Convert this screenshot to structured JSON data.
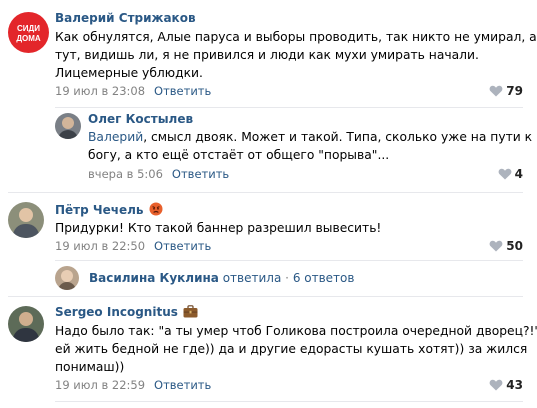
{
  "comments": [
    {
      "author": "Валерий Стрижаков",
      "avatar_text": [
        "СИДИ",
        "ДОМА"
      ],
      "lines": [
        "Как обнулятся, Алые паруса и выборы проводить, так никто не умирал, а",
        "тут, видишь ли, я не привился и люди как мухи умирать начали.",
        "Лицемерные ублюдки."
      ],
      "date": "19 июл в 23:08",
      "reply_label": "Ответить",
      "likes": "79"
    },
    {
      "author": "Олег Костылев",
      "mention": "Валерий",
      "lines": [
        ", смысл двояк. Может и такой. Типа, сколько уже на пути к",
        "богу, а кто ещё отстаёт от общего \"порыва\"..."
      ],
      "date": "вчера в 5:06",
      "reply_label": "Ответить",
      "likes": "4"
    },
    {
      "author": "Пётр Чечель",
      "author_emoji": "angry-face",
      "lines": [
        "Придурки! Кто такой баннер разрешил вывесить!"
      ],
      "date": "19 июл в 22:50",
      "reply_label": "Ответить",
      "likes": "50"
    },
    {
      "author": "Sergeo Incognitus",
      "author_emoji": "briefcase",
      "lines": [
        "Надо было так: \"а ты умер чтоб Голикова построила очередной дворец?!\"",
        "ей жить бедной не где)) да и другие едорасты кушать хотят)) за жился",
        "понимаш))"
      ],
      "date": "19 июл в 22:59",
      "reply_label": "Ответить",
      "likes": "43"
    }
  ],
  "thread": {
    "author": "Василина Куклина",
    "action": "ответила",
    "separator": "·",
    "count": "6 ответов"
  },
  "colors": {
    "link": "#2a5885",
    "meta": "#828282",
    "separator": "#e7e8ec"
  }
}
